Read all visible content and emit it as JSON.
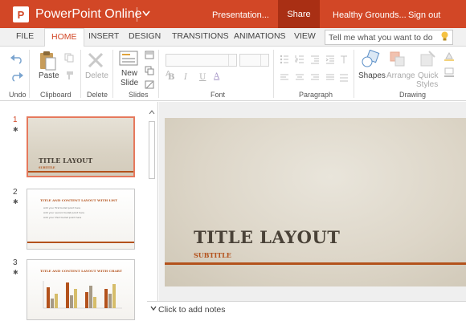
{
  "titlebar": {
    "app_name": "PowerPoint Online",
    "logo_letter": "P",
    "doc_name": "Presentation...",
    "share": "Share",
    "user": "Healthy Grounds...",
    "signout": "Sign out",
    "color": "#d24726"
  },
  "tabs": [
    "FILE",
    "HOME",
    "INSERT",
    "DESIGN",
    "TRANSITIONS",
    "ANIMATIONS",
    "VIEW"
  ],
  "active_tab": "HOME",
  "tellme": "Tell me what you want to do",
  "ribbon": {
    "undo": "Undo",
    "paste": "Paste",
    "clipboard": "Clipboard",
    "delete_btn": "Delete",
    "delete_grp": "Delete",
    "new_slide_1": "New",
    "new_slide_2": "Slide",
    "slides": "Slides",
    "font": "Font",
    "paragraph": "Paragraph",
    "shapes": "Shapes",
    "arrange": "Arrange",
    "quick_1": "Quick",
    "quick_2": "Styles",
    "drawing": "Drawing",
    "bold": "B",
    "italic": "I",
    "underline": "U",
    "fontcolor": "A"
  },
  "thumbnails": [
    {
      "num": "1",
      "title": "TITLE LAYOUT",
      "subtitle": "SUBTITLE"
    },
    {
      "num": "2",
      "title": "TITLE AND CONTENT LAYOUT WITH LIST",
      "bullets": [
        "Add your first bullet point here",
        "Add your second bullet point here",
        "Add your third bullet point here"
      ]
    },
    {
      "num": "3",
      "title": "TITLE AND CONTENT LAYOUT WITH CHART"
    }
  ],
  "slide": {
    "title": "TITLE LAYOUT",
    "subtitle": "SUBTITLE"
  },
  "notes": "Click to add notes"
}
